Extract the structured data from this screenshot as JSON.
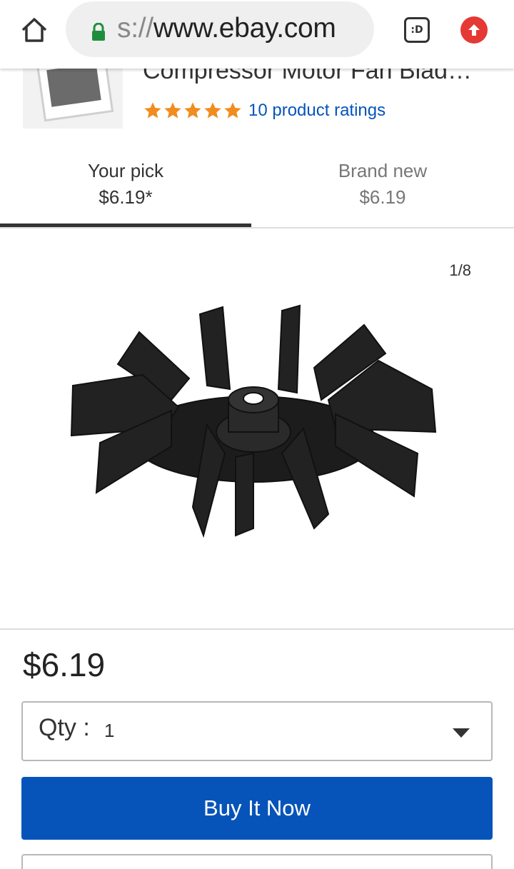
{
  "browser": {
    "url_scheme_fragment": "s://",
    "url_host": "www.ebay.com",
    "tabs_button_label": ":D",
    "icons": {
      "home": "home-icon",
      "lock": "lock-icon",
      "tabs": "tab-switcher-icon",
      "update": "upload-arrow-icon"
    },
    "colors": {
      "lock": "#1e8e3e",
      "update": "#e53935"
    }
  },
  "product": {
    "title": "Compressor Motor Fan Blad…",
    "rating_stars": 5,
    "ratings_link": "10 product ratings",
    "star_color": "#f18c1f"
  },
  "tabs": [
    {
      "label": "Your pick",
      "price": "$6.19*",
      "selected": true
    },
    {
      "label": "Brand new",
      "price": "$6.19",
      "selected": false
    }
  ],
  "gallery": {
    "counter": "1/8"
  },
  "purchase": {
    "price": "$6.19",
    "qty_label": "Qty :",
    "qty_value": "1",
    "buy_now_label": "Buy It Now",
    "accent_color": "#0654ba"
  }
}
